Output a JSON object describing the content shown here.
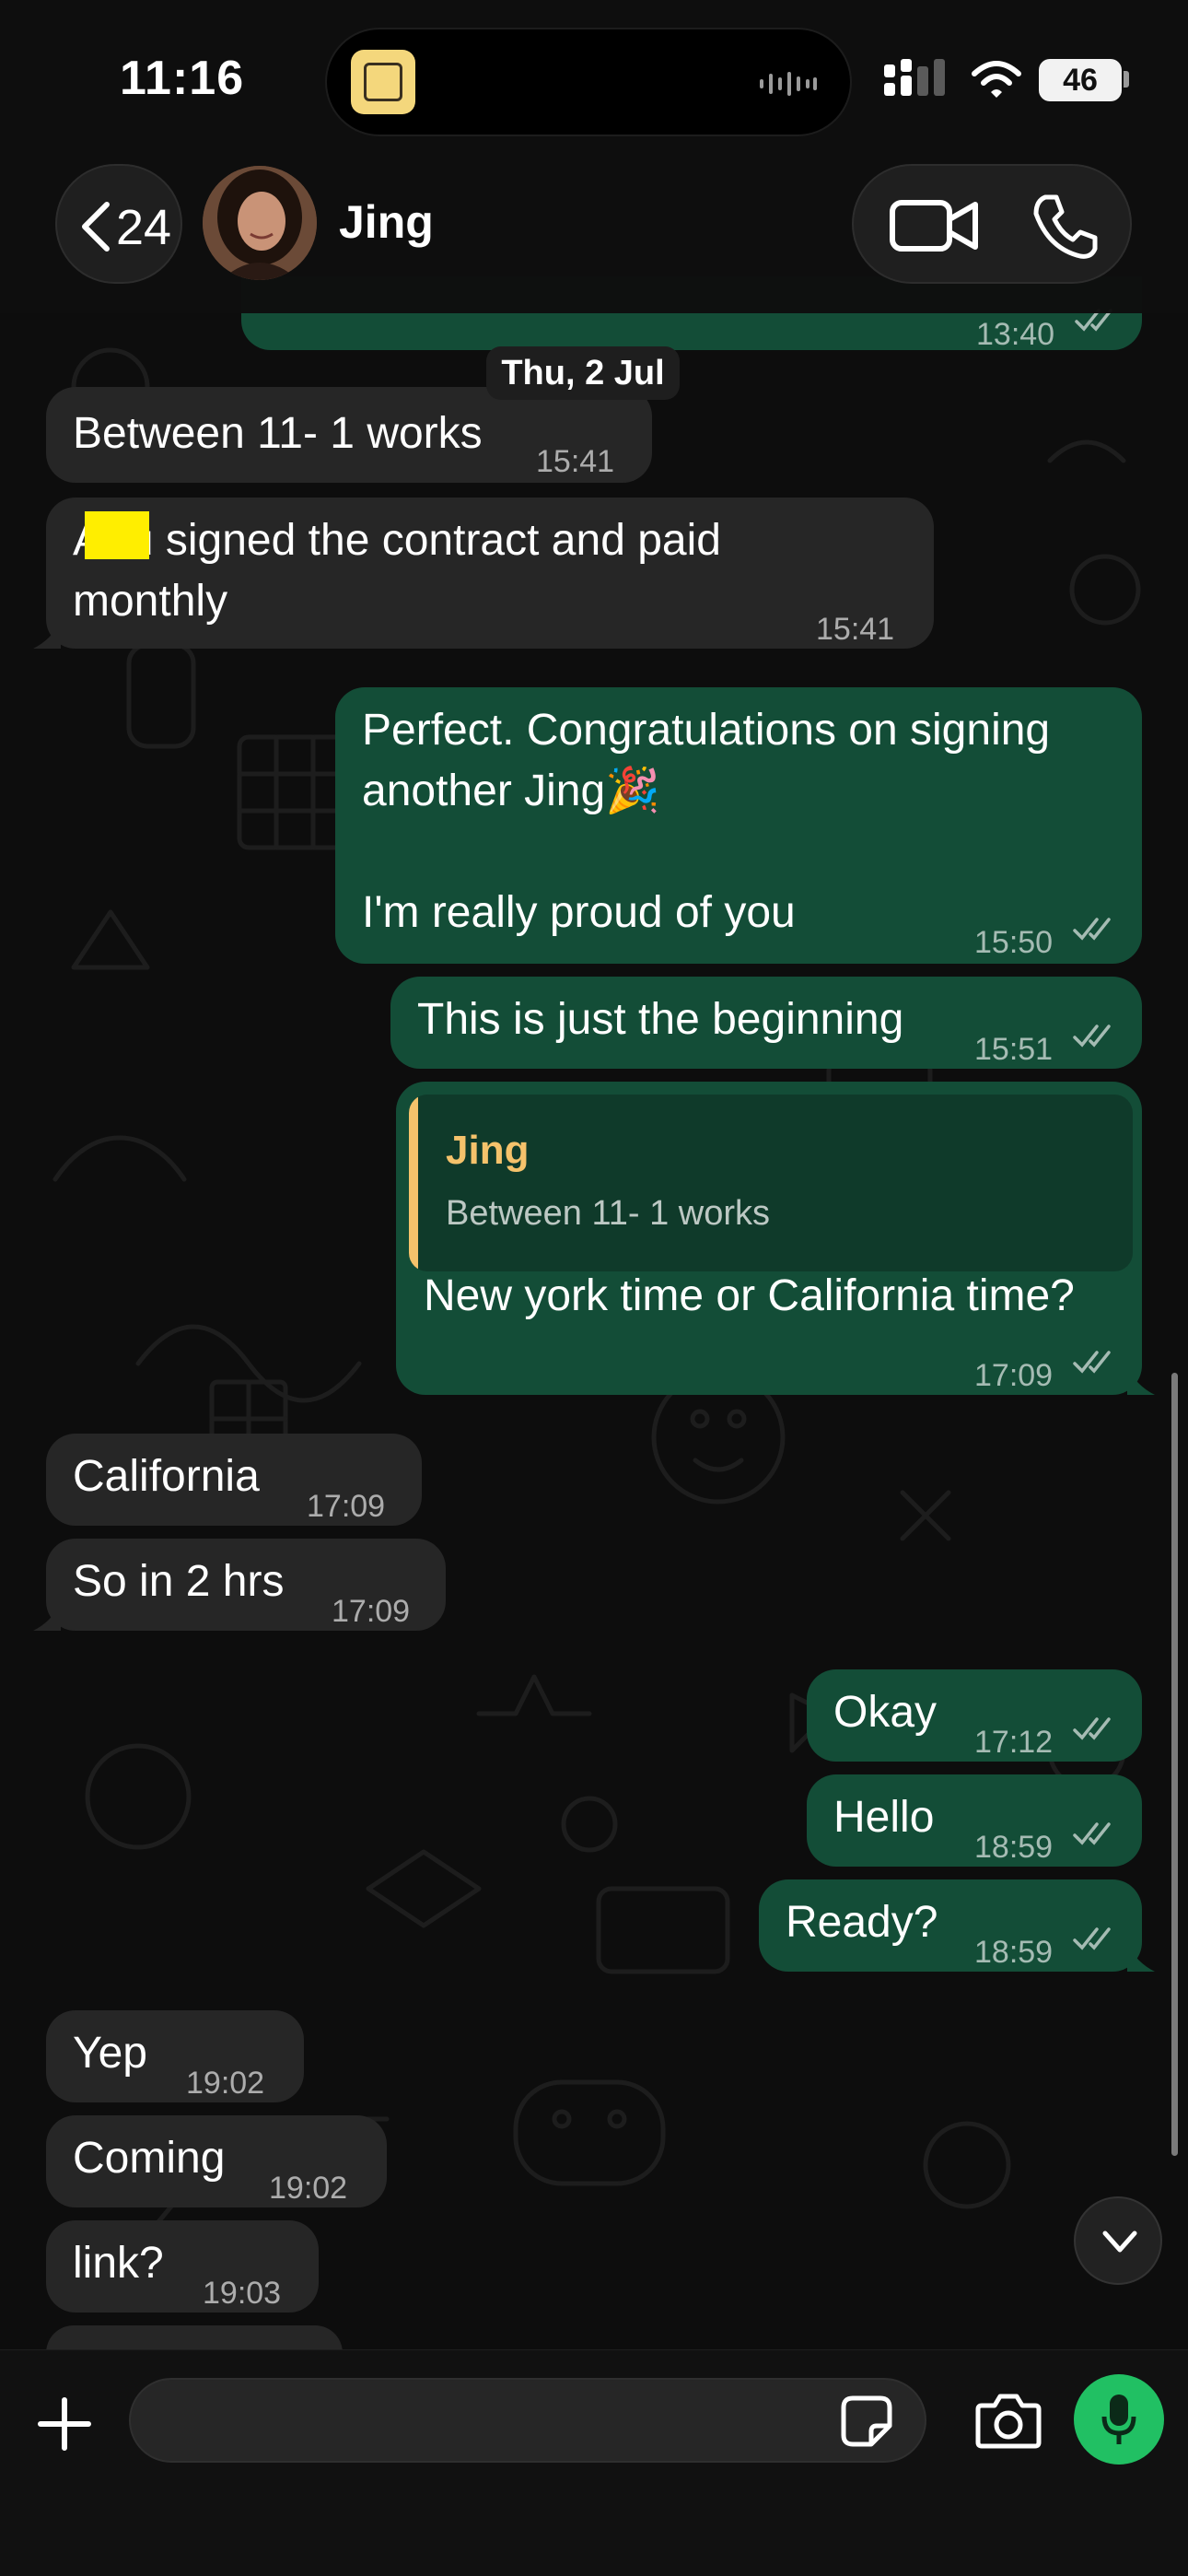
{
  "status_bar": {
    "time": "11:16",
    "battery": "46"
  },
  "header": {
    "back_count": "24",
    "contact_name": "Jing"
  },
  "partial_top_message": {
    "time": "13:40"
  },
  "date_separator": "Thu, 2 Jul",
  "messages": [
    {
      "dir": "in",
      "text": "Between 11- 1 works",
      "time": "15:41"
    },
    {
      "dir": "in",
      "line1": "A   u signed the contract and paid",
      "line2": "monthly",
      "time": "15:41"
    },
    {
      "dir": "out",
      "line1": "Perfect. Congratulations on signing",
      "line2": "another Jing🎉",
      "line3": "I'm really proud of you",
      "time": "15:50"
    },
    {
      "dir": "out",
      "text": "This is just the beginning",
      "time": "15:51"
    },
    {
      "dir": "out",
      "quote_name": "Jing",
      "quote_text": "Between 11- 1 works",
      "text": "New york time or California time?",
      "time": "17:09"
    },
    {
      "dir": "in",
      "text": "California",
      "time": "17:09"
    },
    {
      "dir": "in",
      "text": "So in 2 hrs",
      "time": "17:09"
    },
    {
      "dir": "out",
      "text": "Okay",
      "time": "17:12"
    },
    {
      "dir": "out",
      "text": "Hello",
      "time": "18:59"
    },
    {
      "dir": "out",
      "text": "Ready?",
      "time": "18:59"
    },
    {
      "dir": "in",
      "text": "Yep",
      "time": "19:02"
    },
    {
      "dir": "in",
      "text": "Coming",
      "time": "19:02"
    },
    {
      "dir": "in",
      "text": "link?",
      "time": "19:03"
    }
  ],
  "composer": {
    "placeholder": ""
  },
  "icons": [
    "back-chevron-icon",
    "video-camera-icon",
    "phone-icon",
    "double-check-icon",
    "chevron-down-icon",
    "plus-icon",
    "sticker-icon",
    "camera-icon",
    "microphone-icon",
    "wifi-icon",
    "signal-icon"
  ],
  "colors": {
    "incoming_bubble": "#262626",
    "outgoing_bubble": "#134d37",
    "accent_green": "#21c063",
    "quote_name": "#f5c26b"
  }
}
